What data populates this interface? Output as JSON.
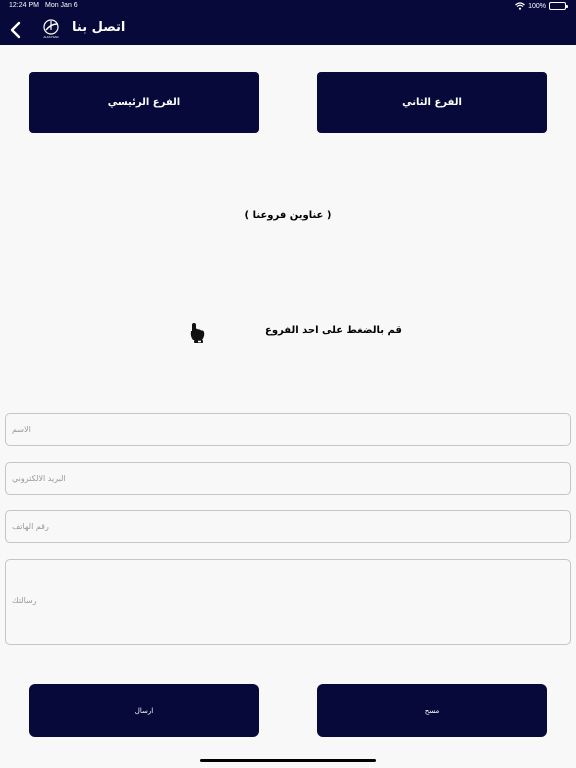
{
  "status_bar": {
    "time": "12:24 PM",
    "date": "Mon Jan 6",
    "battery": "100%",
    "icons": [
      "wifi-icon",
      "battery-icon"
    ]
  },
  "header": {
    "title": "اتصل بنا",
    "logo_text": "ALFAYSAR",
    "back_icon": "chevron-left-icon",
    "background": "#06093a"
  },
  "branches": {
    "main_label": "الفرع الرئيسي",
    "second_label": "الفرع الثاني"
  },
  "addresses_title": "( عناوين فروعنا )",
  "instruction": {
    "text": "قم بالضغط على احد الفروع",
    "icon": "pointing-hand-icon"
  },
  "form": {
    "name_placeholder": "الاسم",
    "email_placeholder": "البريد الالكتروني",
    "phone_placeholder": "رقم الهاتف",
    "message_placeholder": "رسالتك"
  },
  "actions": {
    "send_label": "ارسال",
    "clear_label": "مسح"
  },
  "colors": {
    "accent": "#06093a",
    "background": "#f8f8f8",
    "field_border": "#c5c5c5"
  }
}
